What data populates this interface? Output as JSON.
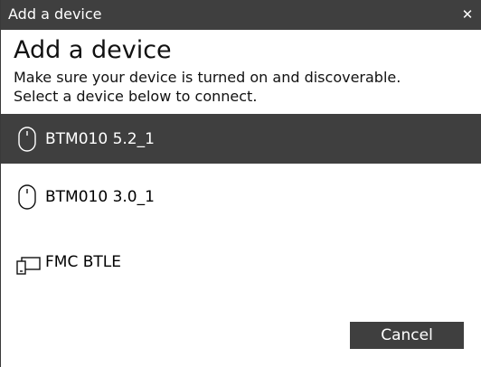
{
  "window": {
    "title": "Add a device",
    "close_glyph": "✕"
  },
  "main": {
    "heading": "Add a device",
    "description_line1": "Make sure your device is turned on and discoverable.",
    "description_line2": "Select a device below to connect."
  },
  "devices": [
    {
      "label": "BTM010 5.2_1",
      "icon": "mouse-icon",
      "selected": true
    },
    {
      "label": "BTM010 3.0_1",
      "icon": "mouse-icon",
      "selected": false
    },
    {
      "label": "FMC BTLE",
      "icon": "devices-icon",
      "selected": false
    }
  ],
  "footer": {
    "cancel_label": "Cancel"
  },
  "colors": {
    "titlebar": "#3f3f3f",
    "selected_row": "#3f3f3f",
    "button": "#3f3f3f",
    "text": "#111111",
    "background": "#ffffff"
  }
}
